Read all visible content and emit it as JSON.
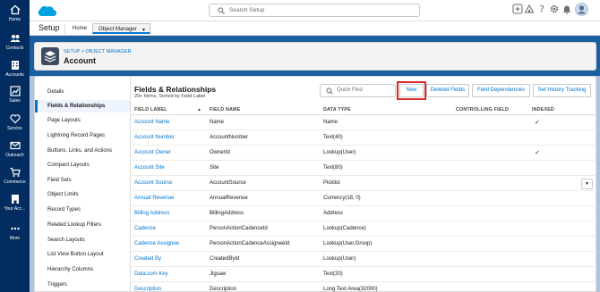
{
  "global_header": {
    "search_placeholder": "Search Setup"
  },
  "rail": {
    "items": [
      {
        "label": "Home"
      },
      {
        "label": "Contacts"
      },
      {
        "label": "Accounts"
      },
      {
        "label": "Sales"
      },
      {
        "label": "Service"
      },
      {
        "label": "Outreach"
      },
      {
        "label": "Commerce"
      },
      {
        "label": "Your Acc..."
      },
      {
        "label": "More"
      }
    ]
  },
  "context_bar": {
    "app_name": "Setup",
    "tabs": [
      {
        "label": "Home"
      },
      {
        "label": "Object Manager"
      }
    ]
  },
  "object_header": {
    "breadcrumb": "SETUP > OBJECT MANAGER",
    "title": "Account"
  },
  "sidebar": {
    "items": [
      {
        "label": "Details"
      },
      {
        "label": "Fields & Relationships"
      },
      {
        "label": "Page Layouts"
      },
      {
        "label": "Lightning Record Pages"
      },
      {
        "label": "Buttons, Links, and Actions"
      },
      {
        "label": "Compact Layouts"
      },
      {
        "label": "Field Sets"
      },
      {
        "label": "Object Limits"
      },
      {
        "label": "Record Types"
      },
      {
        "label": "Related Lookup Filters"
      },
      {
        "label": "Search Layouts"
      },
      {
        "label": "List View Button Layout"
      },
      {
        "label": "Hierarchy Columns"
      },
      {
        "label": "Triggers"
      }
    ],
    "active_index": 1
  },
  "section": {
    "title": "Fields & Relationships",
    "subtitle": "29+ Items, Sorted by Field Label",
    "quick_find_placeholder": "Quick Find",
    "buttons": {
      "new": "New",
      "deleted": "Deleted Fields",
      "dependencies": "Field Dependencies",
      "history": "Set History Tracking"
    }
  },
  "table": {
    "columns": [
      "FIELD LABEL",
      "FIELD NAME",
      "DATA TYPE",
      "CONTROLLING FIELD",
      "INDEXED"
    ],
    "rows": [
      {
        "label": "Account Name",
        "name": "Name",
        "type": "Name",
        "controlling": "",
        "indexed": "✓"
      },
      {
        "label": "Account Number",
        "name": "AccountNumber",
        "type": "Text(40)",
        "controlling": "",
        "indexed": ""
      },
      {
        "label": "Account Owner",
        "name": "OwnerId",
        "type": "Lookup(User)",
        "controlling": "",
        "indexed": "✓"
      },
      {
        "label": "Account Site",
        "name": "Site",
        "type": "Text(80)",
        "controlling": "",
        "indexed": ""
      },
      {
        "label": "Account Source",
        "name": "AccountSource",
        "type": "Picklist",
        "controlling": "",
        "indexed": ""
      },
      {
        "label": "Annual Revenue",
        "name": "AnnualRevenue",
        "type": "Currency(18, 0)",
        "controlling": "",
        "indexed": ""
      },
      {
        "label": "Billing Address",
        "name": "BillingAddress",
        "type": "Address",
        "controlling": "",
        "indexed": ""
      },
      {
        "label": "Cadence",
        "name": "PersonActionCadenceId",
        "type": "Lookup(Cadence)",
        "controlling": "",
        "indexed": ""
      },
      {
        "label": "Cadence Assignee",
        "name": "PersonActionCadenceAssigneeId",
        "type": "Lookup(User,Group)",
        "controlling": "",
        "indexed": ""
      },
      {
        "label": "Created By",
        "name": "CreatedById",
        "type": "Lookup(User)",
        "controlling": "",
        "indexed": ""
      },
      {
        "label": "Data.com Key",
        "name": "Jigsaw",
        "type": "Text(20)",
        "controlling": "",
        "indexed": ""
      },
      {
        "label": "Description",
        "name": "Description",
        "type": "Long Text Area(32000)",
        "controlling": "",
        "indexed": ""
      }
    ]
  },
  "colors": {
    "rail_bg": "#032d60",
    "brand_blue": "#0176d3",
    "band_blue": "#1b5f9e",
    "highlight_red": "#d92a2a"
  }
}
